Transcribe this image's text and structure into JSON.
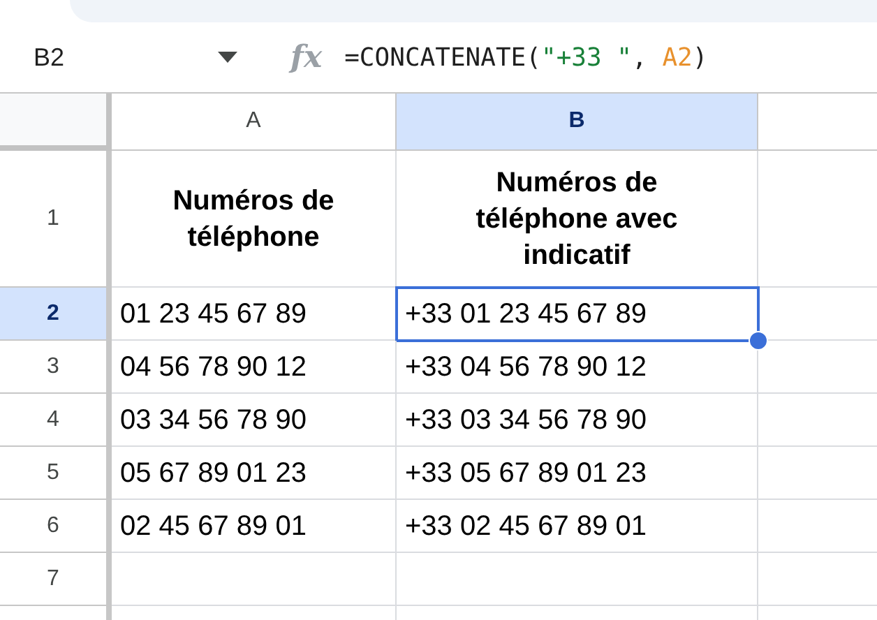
{
  "name_box": {
    "value": "B2"
  },
  "formula_bar": {
    "fx_label": "fx",
    "parts": [
      {
        "kind": "plain",
        "text": "=CONCATENATE("
      },
      {
        "kind": "string",
        "text": "\"+33 \""
      },
      {
        "kind": "plain",
        "text": ", "
      },
      {
        "kind": "ref",
        "text": "A2"
      },
      {
        "kind": "plain",
        "text": ")"
      }
    ]
  },
  "columns": [
    {
      "label": "A",
      "selected": false
    },
    {
      "label": "B",
      "selected": true
    }
  ],
  "rows": [
    {
      "number": "1",
      "kind": "header",
      "selected": false,
      "cells": [
        {
          "text": "Numéros de téléphone",
          "selected": false
        },
        {
          "text": "Numéros de téléphone avec indicatif",
          "selected": false
        }
      ]
    },
    {
      "number": "2",
      "kind": "data",
      "selected": true,
      "cells": [
        {
          "text": "01 23 45 67 89",
          "selected": false
        },
        {
          "text": "+33 01 23 45 67 89",
          "selected": true
        }
      ]
    },
    {
      "number": "3",
      "kind": "data",
      "selected": false,
      "cells": [
        {
          "text": "04 56 78 90 12",
          "selected": false
        },
        {
          "text": "+33 04 56 78 90 12",
          "selected": false
        }
      ]
    },
    {
      "number": "4",
      "kind": "data",
      "selected": false,
      "cells": [
        {
          "text": "03 34 56 78 90",
          "selected": false
        },
        {
          "text": "+33 03 34 56 78 90",
          "selected": false
        }
      ]
    },
    {
      "number": "5",
      "kind": "data",
      "selected": false,
      "cells": [
        {
          "text": "05 67 89 01 23",
          "selected": false
        },
        {
          "text": "+33 05 67 89 01 23",
          "selected": false
        }
      ]
    },
    {
      "number": "6",
      "kind": "data",
      "selected": false,
      "cells": [
        {
          "text": "02 45 67 89 01",
          "selected": false
        },
        {
          "text": "+33 02 45 67 89 01",
          "selected": false
        }
      ]
    },
    {
      "number": "7",
      "kind": "data",
      "selected": false
    }
  ]
}
